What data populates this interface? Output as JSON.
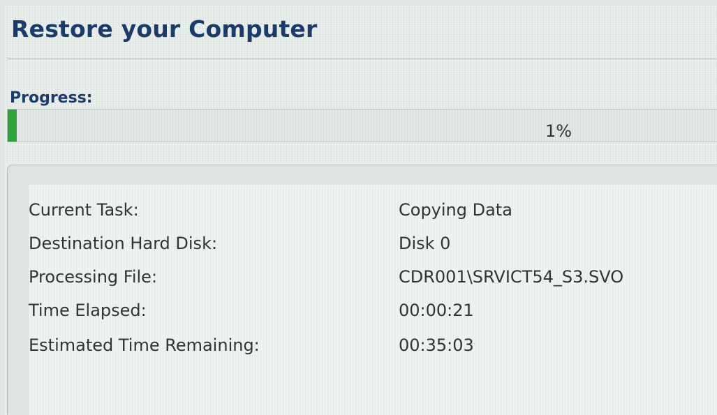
{
  "window": {
    "title": "Restore your Computer"
  },
  "progress": {
    "label": "Progress:",
    "percent_text": "1%",
    "fraction": 0.01,
    "fill_color": "#2ea53b"
  },
  "details": [
    {
      "label": "Current Task:",
      "value": "Copying Data"
    },
    {
      "label": "Destination Hard Disk:",
      "value": "Disk 0"
    },
    {
      "label": "Processing File:",
      "value": "CDR001\\SRVICT54_S3.SVO"
    },
    {
      "label": "Time Elapsed:",
      "value": "00:00:21"
    },
    {
      "label": "Estimated Time Remaining:",
      "value": "00:35:03"
    }
  ],
  "colors": {
    "heading": "#1b3b6b",
    "text": "#333333"
  }
}
